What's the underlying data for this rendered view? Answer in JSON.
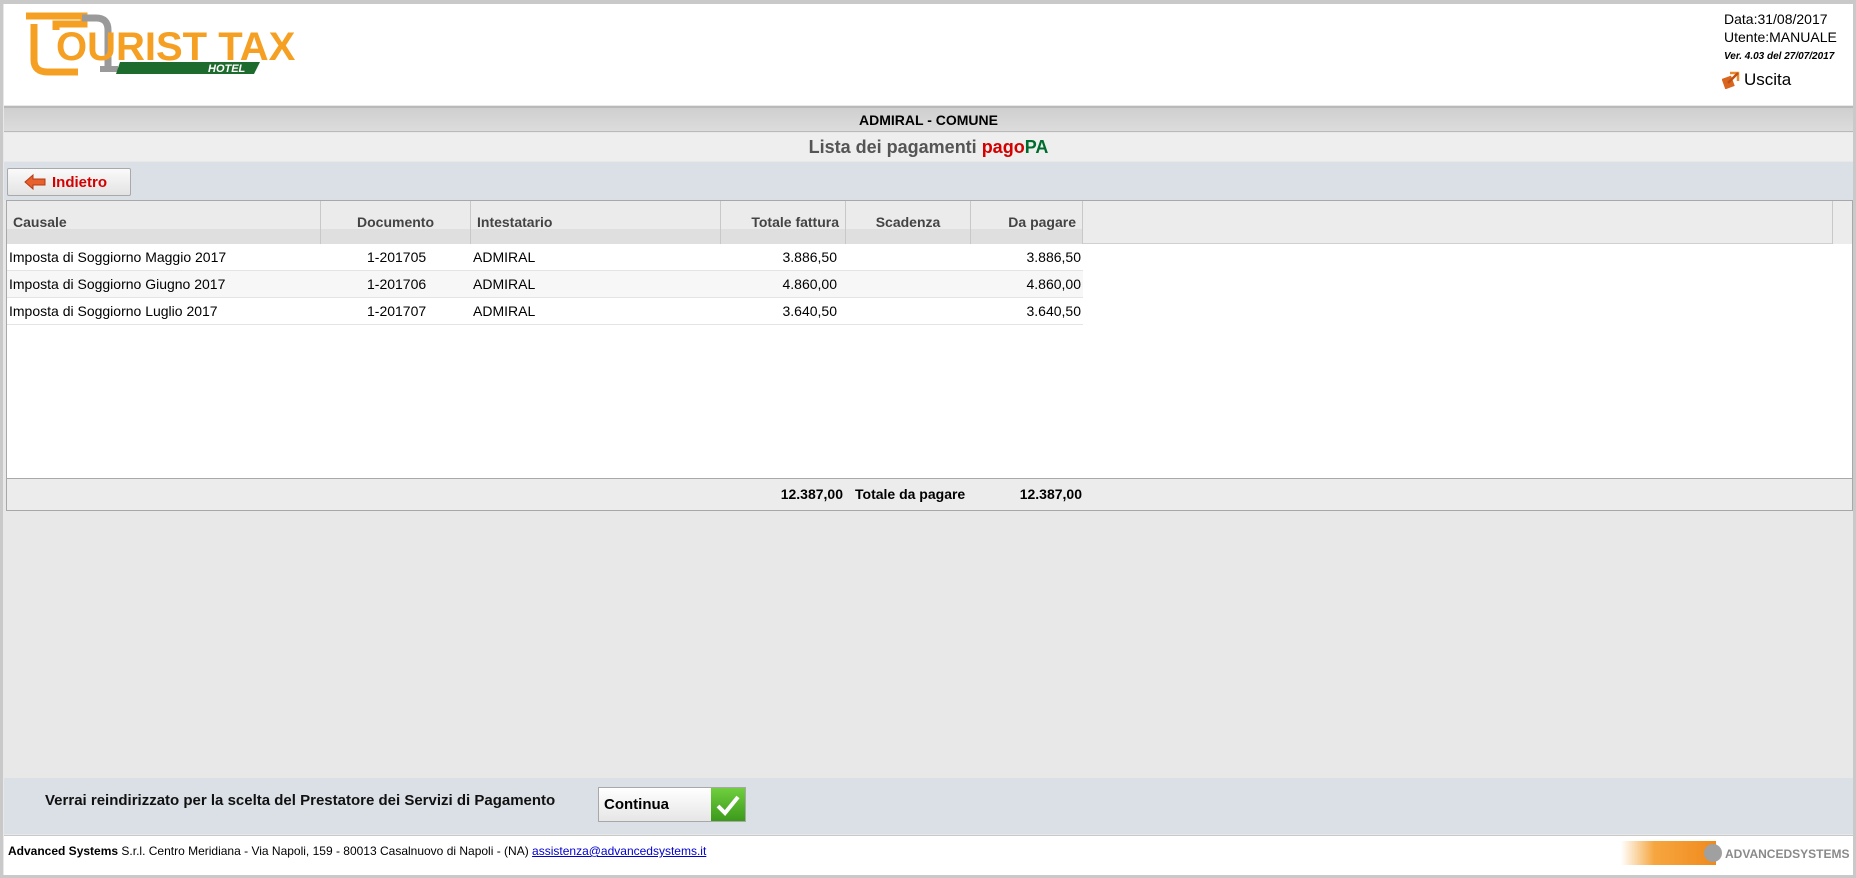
{
  "header": {
    "logo_main": "OURIST TAX",
    "logo_sub": "HOTEL",
    "date": "Data:31/08/2017",
    "user": "Utente:MANUALE",
    "version": "Ver. 4.03 del 27/07/2017",
    "logout_label": "Uscita"
  },
  "title_bar": "ADMIRAL - COMUNE",
  "subtitle": {
    "prefix": "Lista dei pagamenti ",
    "pago": "pago",
    "pa": "PA"
  },
  "toolbar": {
    "back_label": "Indietro"
  },
  "grid": {
    "columns": [
      "Causale",
      "Documento",
      "Intestatario",
      "Totale fattura",
      "Scadenza",
      "Da pagare"
    ],
    "rows": [
      {
        "causale": "Imposta di Soggiorno Maggio 2017",
        "documento": "1-201705",
        "intestatario": "ADMIRAL",
        "totale": "3.886,50",
        "scadenza": "",
        "da_pagare": "3.886,50"
      },
      {
        "causale": "Imposta di Soggiorno Giugno 2017",
        "documento": "1-201706",
        "intestatario": "ADMIRAL",
        "totale": "4.860,00",
        "scadenza": "",
        "da_pagare": "4.860,00"
      },
      {
        "causale": "Imposta di Soggiorno Luglio 2017",
        "documento": "1-201707",
        "intestatario": "ADMIRAL",
        "totale": "3.640,50",
        "scadenza": "",
        "da_pagare": "3.640,50"
      }
    ],
    "footer": {
      "totale_fattura": "12.387,00",
      "label": "Totale da pagare",
      "da_pagare": "12.387,00"
    }
  },
  "action": {
    "message": "Verrai reindirizzato per la scelta del Prestatore dei Servizi di Pagamento",
    "continue_label": "Continua"
  },
  "footer": {
    "company_bold": "Advanced Systems",
    "address": " S.r.l. Centro Meridiana - Via Napoli, 159 - 80013 Casalnuovo di Napoli - (NA) ",
    "email": "assistenza@advancedsystems.it",
    "logo_text": "ADVANCEDSYSTEMS"
  },
  "colors": {
    "brand_orange": "#f5a023",
    "brand_green": "#1e6b2e",
    "pago_red": "#d40000",
    "bar_blue_gray": "#dbe0e6"
  },
  "icons": [
    "logout-icon",
    "back-arrow-icon",
    "checkmark-icon"
  ]
}
